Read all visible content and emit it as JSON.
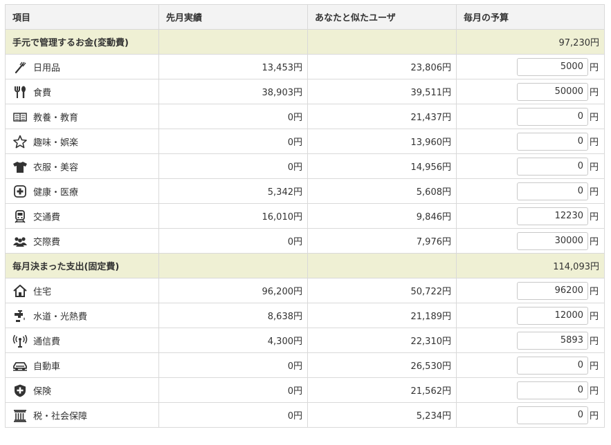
{
  "headers": {
    "item": "項目",
    "last_month": "先月実績",
    "similar_users": "あなたと似たユーザ",
    "monthly_budget": "毎月の予算"
  },
  "unit": "円",
  "sections": [
    {
      "title": "手元で管理するお金(変動費)",
      "total": "97,230円",
      "rows": [
        {
          "icon": "toothbrush-icon",
          "label": "日用品",
          "last": "13,453円",
          "similar": "23,806円",
          "budget": "5000"
        },
        {
          "icon": "fork-spoon-icon",
          "label": "食費",
          "last": "38,903円",
          "similar": "39,511円",
          "budget": "50000"
        },
        {
          "icon": "book-icon",
          "label": "教養・教育",
          "last": "0円",
          "similar": "21,437円",
          "budget": "0"
        },
        {
          "icon": "star-icon",
          "label": "趣味・娯楽",
          "last": "0円",
          "similar": "13,960円",
          "budget": "0"
        },
        {
          "icon": "shirt-icon",
          "label": "衣服・美容",
          "last": "0円",
          "similar": "14,956円",
          "budget": "0"
        },
        {
          "icon": "medical-cross-icon",
          "label": "健康・医療",
          "last": "5,342円",
          "similar": "5,608円",
          "budget": "0"
        },
        {
          "icon": "train-icon",
          "label": "交通費",
          "last": "16,010円",
          "similar": "9,846円",
          "budget": "12230"
        },
        {
          "icon": "people-icon",
          "label": "交際費",
          "last": "0円",
          "similar": "7,976円",
          "budget": "30000"
        }
      ]
    },
    {
      "title": "毎月決まった支出(固定費)",
      "total": "114,093円",
      "rows": [
        {
          "icon": "house-icon",
          "label": "住宅",
          "last": "96,200円",
          "similar": "50,722円",
          "budget": "96200"
        },
        {
          "icon": "faucet-icon",
          "label": "水道・光熱費",
          "last": "8,638円",
          "similar": "21,189円",
          "budget": "12000"
        },
        {
          "icon": "antenna-icon",
          "label": "通信費",
          "last": "4,300円",
          "similar": "22,310円",
          "budget": "5893"
        },
        {
          "icon": "car-icon",
          "label": "自動車",
          "last": "0円",
          "similar": "26,530円",
          "budget": "0"
        },
        {
          "icon": "shield-icon",
          "label": "保険",
          "last": "0円",
          "similar": "21,562円",
          "budget": "0"
        },
        {
          "icon": "pillar-icon",
          "label": "税・社会保障",
          "last": "0円",
          "similar": "5,234円",
          "budget": "0"
        }
      ]
    }
  ]
}
